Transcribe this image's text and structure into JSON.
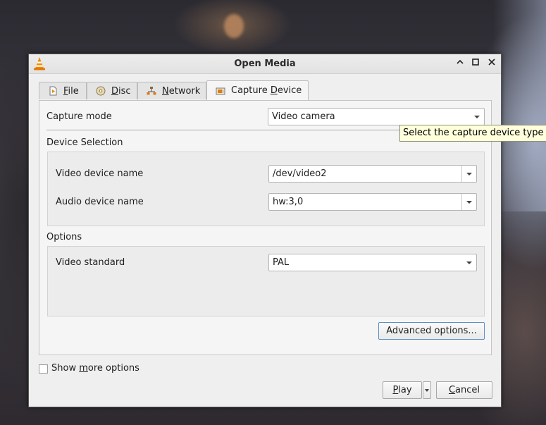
{
  "window": {
    "title": "Open Media"
  },
  "tabs": [
    {
      "pre": "",
      "accel": "F",
      "post": "ile",
      "icon": "file-icon"
    },
    {
      "pre": "",
      "accel": "D",
      "post": "isc",
      "icon": "disc-icon"
    },
    {
      "pre": "",
      "accel": "N",
      "post": "etwork",
      "icon": "network-icon"
    },
    {
      "pre": "Capture ",
      "accel": "D",
      "post": "evice",
      "icon": "capture-device-icon"
    }
  ],
  "capture": {
    "mode_label": "Capture mode",
    "mode_value": "Video camera",
    "tooltip": "Select the capture device type"
  },
  "device_selection": {
    "title": "Device Selection",
    "video_label": "Video device name",
    "video_value": "/dev/video2",
    "audio_label": "Audio device name",
    "audio_value": "hw:3,0"
  },
  "options": {
    "title": "Options",
    "standard_label": "Video standard",
    "standard_value": "PAL",
    "advanced_button": "Advanced options..."
  },
  "footer": {
    "more_pre": "Show ",
    "more_accel": "m",
    "more_post": "ore options",
    "more_checked": false,
    "play_accel": "P",
    "play_post": "lay",
    "cancel_accel": "C",
    "cancel_post": "ancel"
  },
  "colors": {
    "window_bg": "#efefef",
    "tooltip_bg": "#ffffdc",
    "focus_border": "#5b8fc7",
    "vlc_orange": "#f08a00"
  }
}
